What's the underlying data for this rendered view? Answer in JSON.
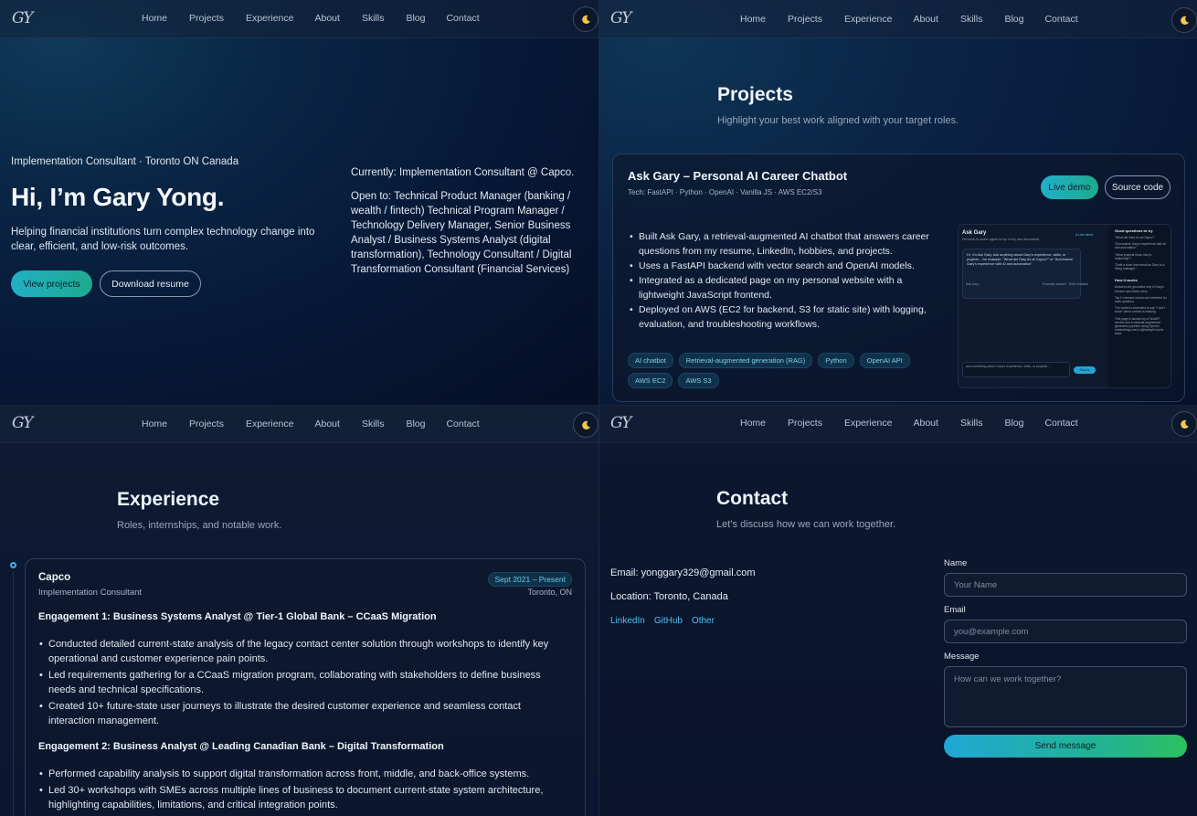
{
  "nav": {
    "logo": "GY",
    "links": [
      "Home",
      "Projects",
      "Experience",
      "About",
      "Skills",
      "Blog",
      "Contact"
    ],
    "theme_icon": "moon-icon"
  },
  "hero": {
    "subtitle": "Implementation Consultant · Toronto ON Canada",
    "title": "Hi, I’m Gary Yong.",
    "description": "Helping financial institutions turn complex technology change into clear, efficient, and low-risk outcomes.",
    "primary_button": "View projects",
    "secondary_button": "Download resume",
    "currently": "Currently: Implementation Consultant @ Capco.",
    "open_to": "Open to: Technical Product Manager (banking / wealth / fintech) Technical Program Manager / Technology Delivery Manager, Senior Business Analyst / Business Systems Analyst (digital transformation), Technology Consultant / Digital Transformation Consultant (Financial Services)"
  },
  "projects": {
    "title": "Projects",
    "subtitle": "Highlight your best work aligned with your target roles.",
    "card": {
      "title": "Ask Gary – Personal AI Career Chatbot",
      "tech": "Tech: FastAPI · Python · OpenAI · Vanilla JS · AWS EC2/S3",
      "live_demo": "Live demo",
      "source_code": "Source code",
      "bullets": [
        "Built Ask Gary, a retrieval-augmented AI chatbot that answers career questions from my resume, LinkedIn, hobbies, and projects.",
        "Uses a FastAPI backend with vector search and OpenAI models.",
        "Integrated as a dedicated page on my personal website with a lightweight JavaScript frontend.",
        "Deployed on AWS (EC2 for backend, S3 for static site) with logging, evaluation, and troubleshooting workflows."
      ],
      "tags": [
        "AI chatbot",
        "Retrieval-augmented generation (RAG)",
        "Python",
        "OpenAI API",
        "AWS EC2",
        "AWS S3"
      ],
      "preview": {
        "app_title": "Ask Gary",
        "app_sub": "Personal AI career agent on top of my own documents",
        "live_badge": "● Live demo",
        "chat_text": "Hi, I'm Ask Gary. Ask anything about Gary's experience, skills, or projects – for example: \"What did Gary do at Capco?\" or \"Summarize Gary's experience with AI and automation\".",
        "chat_author": "Ask Gary",
        "chat_meta": "Example answer · RAG-enabled",
        "input_text": "ask something about Gary's experience, skills, or projects...",
        "send": "Send ▸",
        "side_title": "Good questions to try",
        "side_items": [
          "\"What did Gary do at Capco?\"",
          "\"Summarize Gary's experience with AI and automation.\"",
          "\"What projects show Gary's leadership?\"",
          "\"Draft a short intro email as Gary to a hiring manager.\""
        ],
        "how_title": "How it works",
        "how_items": [
          "Answers are grounded only in Gary's resume and career docs.",
          "Top-K relevant chunks are retrieved for each question.",
          "The model is instructed to say \"I don't know\" when context is missing.",
          "This page is backed by a FastAPI service and a retrieval-augmented generation pipeline using OpenAI embeddings and a lightweight vector store."
        ]
      }
    }
  },
  "experience": {
    "title": "Experience",
    "subtitle": "Roles, internships, and notable work.",
    "company": "Capco",
    "role": "Implementation Consultant",
    "date": "Sept 2021 – Present",
    "location": "Toronto, ON",
    "engagement1": {
      "title": "Engagement 1: Business Systems Analyst @ Tier-1 Global Bank – CCaaS Migration",
      "bullets": [
        "Conducted detailed current-state analysis of the legacy contact center solution through workshops to identify key operational and customer experience pain points.",
        "Led requirements gathering for a CCaaS migration program, collaborating with stakeholders to define business needs and technical specifications.",
        "Created 10+ future-state user journeys to illustrate the desired customer experience and seamless contact interaction management."
      ]
    },
    "engagement2": {
      "title": "Engagement 2: Business Analyst @ Leading Canadian Bank – Digital Transformation",
      "bullets": [
        "Performed capability analysis to support digital transformation across front, middle, and back-office systems.",
        "Led 30+ workshops with SMEs across multiple lines of business to document current-state system architecture, highlighting capabilities, limitations, and critical integration points."
      ]
    }
  },
  "contact": {
    "title": "Contact",
    "subtitle": "Let’s discuss how we can work together.",
    "email": "Email: yonggary329@gmail.com",
    "location": "Location: Toronto, Canada",
    "links": [
      "LinkedIn",
      "GitHub",
      "Other"
    ],
    "form": {
      "name_label": "Name",
      "name_placeholder": "Your Name",
      "email_label": "Email",
      "email_placeholder": "you@example.com",
      "message_label": "Message",
      "message_placeholder": "How can we work together?",
      "send": "Send message"
    }
  },
  "colors": {
    "accent": "#20b0c8",
    "link": "#4ec0ee",
    "background": "#0b1224"
  }
}
